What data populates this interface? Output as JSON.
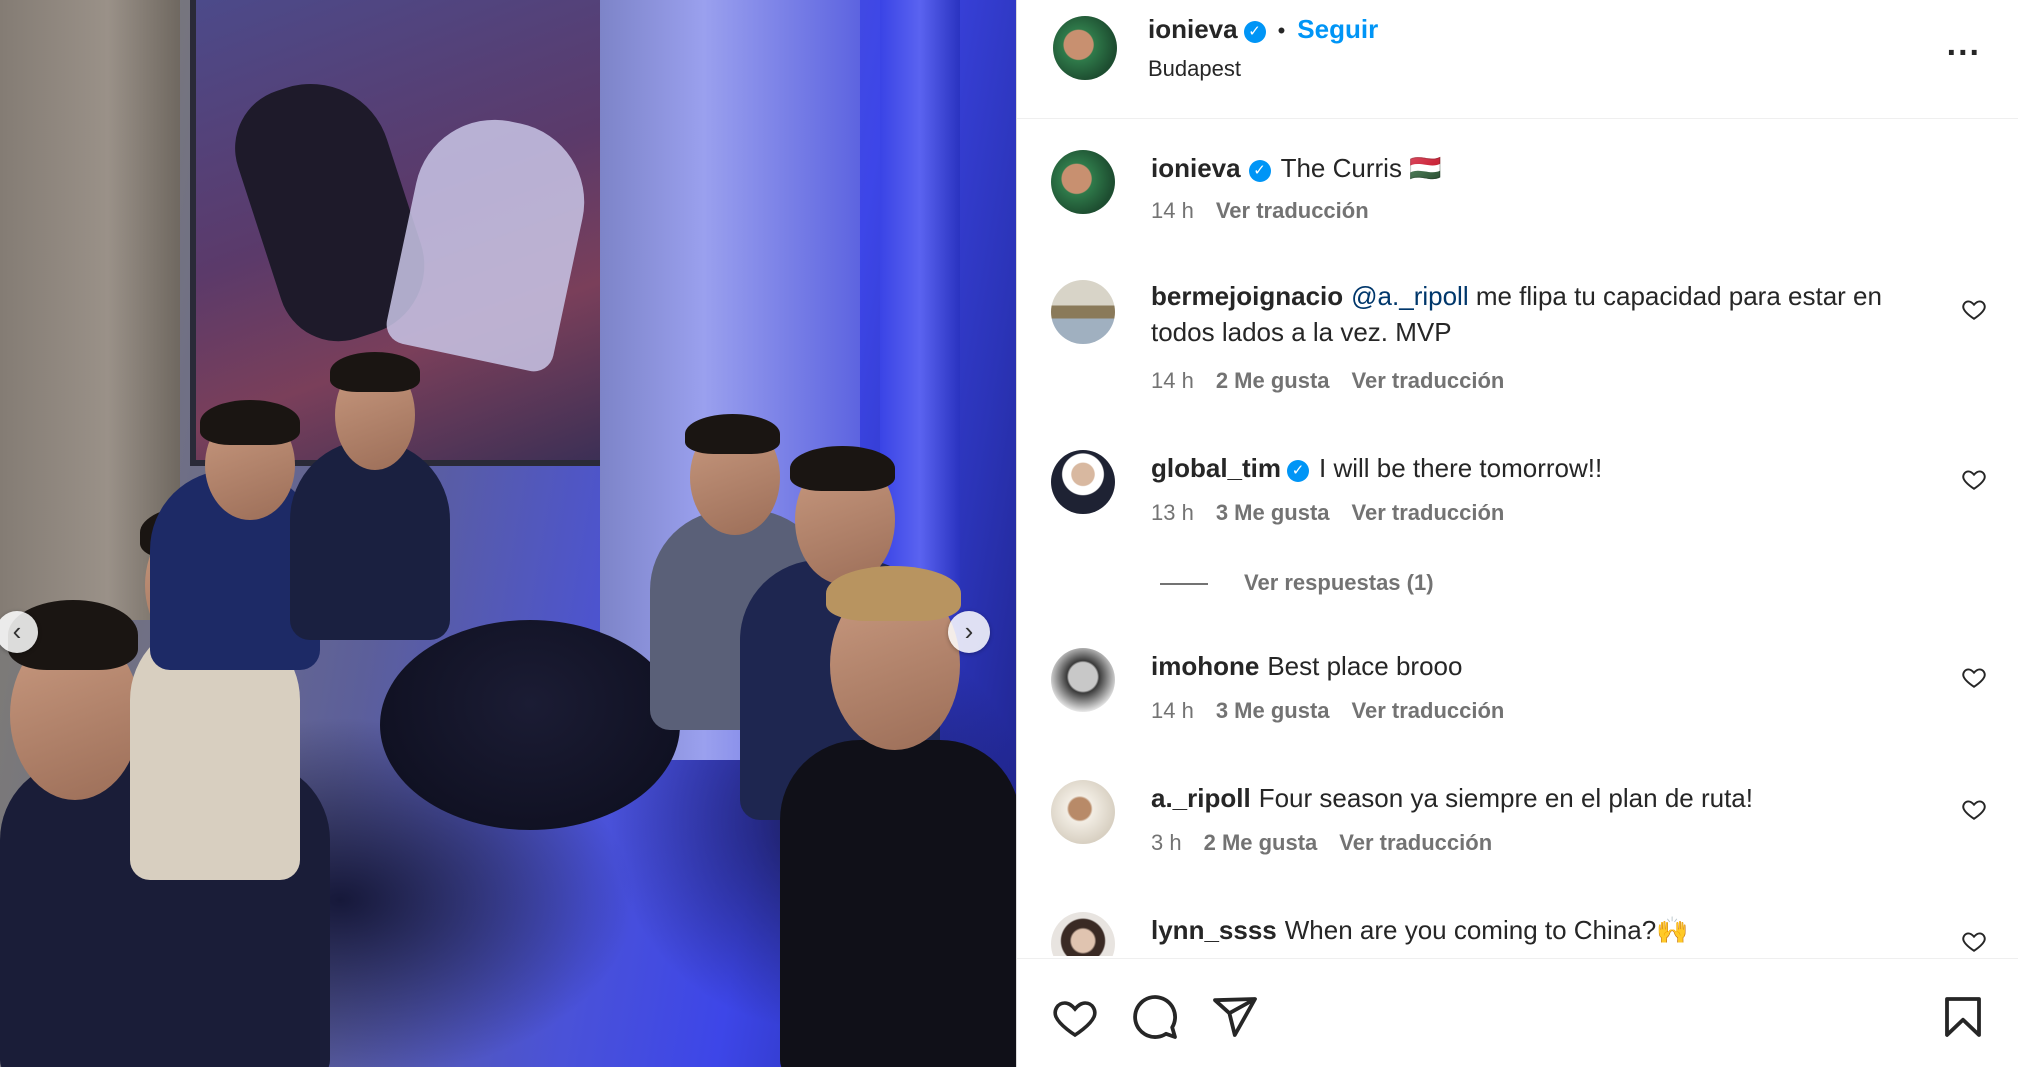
{
  "photo": {
    "prev_icon": "chevron-left-icon",
    "next_icon": "chevron-right-icon"
  },
  "header": {
    "username": "ionieva",
    "separator": "•",
    "follow_label": "Seguir",
    "location": "Budapest",
    "more_icon": "more-horizontal-icon",
    "more_label": "..."
  },
  "caption": {
    "username": "ionieva",
    "text": "The Curris 🇭🇺",
    "time": "14 h",
    "translate": "Ver traducción"
  },
  "comments": [
    {
      "username": "bermejoignacio",
      "verified": false,
      "mention": "@a._ripoll",
      "text": " me flipa tu capacidad para estar en todos lados a la vez. MVP",
      "time": "14 h",
      "likes": "2 Me gusta",
      "translate": "Ver traducción"
    },
    {
      "username": "global_tim",
      "verified": true,
      "mention": "",
      "text": "I will be there tomorrow!!",
      "time": "13 h",
      "likes": "3 Me gusta",
      "translate": "Ver traducción",
      "replies": "Ver respuestas (1)"
    },
    {
      "username": "imohone",
      "verified": false,
      "mention": "",
      "text": "Best place brooo",
      "time": "14 h",
      "likes": "3 Me gusta",
      "translate": "Ver traducción"
    },
    {
      "username": "a._ripoll",
      "verified": false,
      "mention": "",
      "text": "Four season ya siempre en el plan de ruta!",
      "time": "3 h",
      "likes": "2 Me gusta",
      "translate": "Ver traducción"
    },
    {
      "username": "lynn_ssss",
      "verified": false,
      "mention": "",
      "text": "When are you coming to China?🙌",
      "time": "",
      "likes": "",
      "translate": ""
    }
  ],
  "actions": {
    "like_icon": "heart-icon",
    "comment_icon": "comment-icon",
    "share_icon": "send-icon",
    "save_icon": "bookmark-icon"
  },
  "colors": {
    "accent": "#0095f6",
    "text": "#262626",
    "muted": "#737373",
    "mention": "#00376b"
  }
}
